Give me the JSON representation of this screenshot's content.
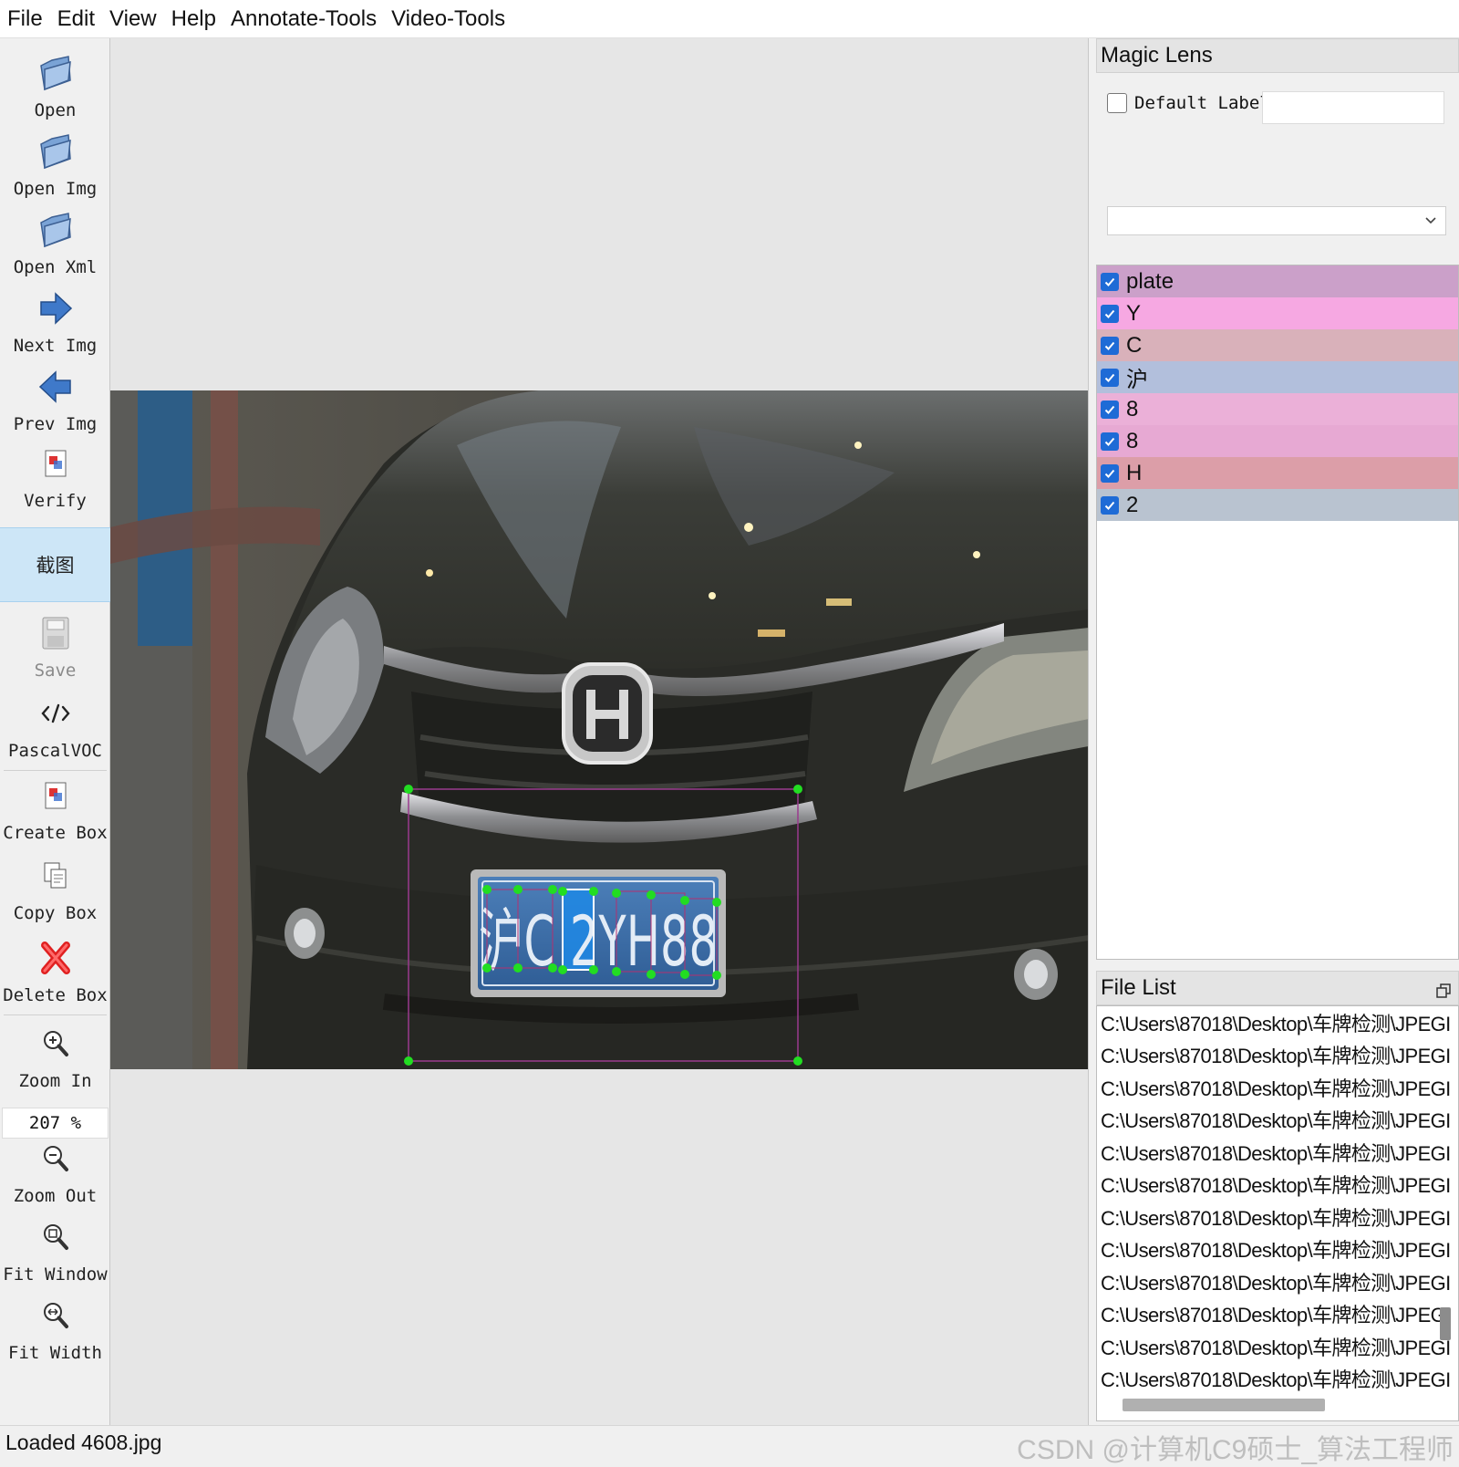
{
  "menu": [
    "File",
    "Edit",
    "View",
    "Help",
    "Annotate-Tools",
    "Video-Tools"
  ],
  "toolbar": {
    "open": "Open",
    "open_img": "Open Img",
    "open_xml": "Open Xml",
    "next_img": "Next Img",
    "prev_img": "Prev Img",
    "verify": "Verify",
    "screenshot": "截图",
    "save": "Save",
    "format": "PascalVOC",
    "create_box": "Create Box",
    "copy_box": "Copy Box",
    "delete_box": "Delete Box",
    "zoom_in": "Zoom In",
    "zoom_value": "207 %",
    "zoom_out": "Zoom Out",
    "fit_window": "Fit Window",
    "fit_width": "Fit Width"
  },
  "magic_lens": {
    "title": "Magic Lens",
    "default_label": "Default Label",
    "default_label_value": "",
    "combo_value": ""
  },
  "labels": [
    {
      "text": "plate",
      "color": "#cba0c9",
      "checked": true
    },
    {
      "text": "Y",
      "color": "#f6a8e2",
      "checked": true
    },
    {
      "text": "C",
      "color": "#d9b1ba",
      "checked": true
    },
    {
      "text": "沪",
      "color": "#b2bfdc",
      "checked": true
    },
    {
      "text": "8",
      "color": "#ebb0d8",
      "checked": true
    },
    {
      "text": "8",
      "color": "#e7a9d3",
      "checked": true
    },
    {
      "text": "H",
      "color": "#dc9ea8",
      "checked": true
    },
    {
      "text": "2",
      "color": "#b9c3d0",
      "checked": true
    }
  ],
  "file_list": {
    "title": "File List",
    "items": [
      "C:\\Users\\87018\\Desktop\\车牌检测\\JPEGI",
      "C:\\Users\\87018\\Desktop\\车牌检测\\JPEGI",
      "C:\\Users\\87018\\Desktop\\车牌检测\\JPEGI",
      "C:\\Users\\87018\\Desktop\\车牌检测\\JPEGI",
      "C:\\Users\\87018\\Desktop\\车牌检测\\JPEGI",
      "C:\\Users\\87018\\Desktop\\车牌检测\\JPEGI",
      "C:\\Users\\87018\\Desktop\\车牌检测\\JPEGI",
      "C:\\Users\\87018\\Desktop\\车牌检测\\JPEGI",
      "C:\\Users\\87018\\Desktop\\车牌检测\\JPEGI",
      "C:\\Users\\87018\\Desktop\\车牌检测\\JPEGI",
      "C:\\Users\\87018\\Desktop\\车牌检测\\JPEGI",
      "C:\\Users\\87018\\Desktop\\车牌检测\\JPEGI"
    ]
  },
  "image": {
    "plate_text": "沪C 2YH88"
  },
  "status": "Loaded 4608.jpg",
  "watermark": "CSDN @计算机C9硕士_算法工程师",
  "colors": {
    "accent": "#1e6bd6",
    "handle": "#22dd22",
    "selected_box": "#1e88e5",
    "active_tool": "#cde6f7"
  }
}
